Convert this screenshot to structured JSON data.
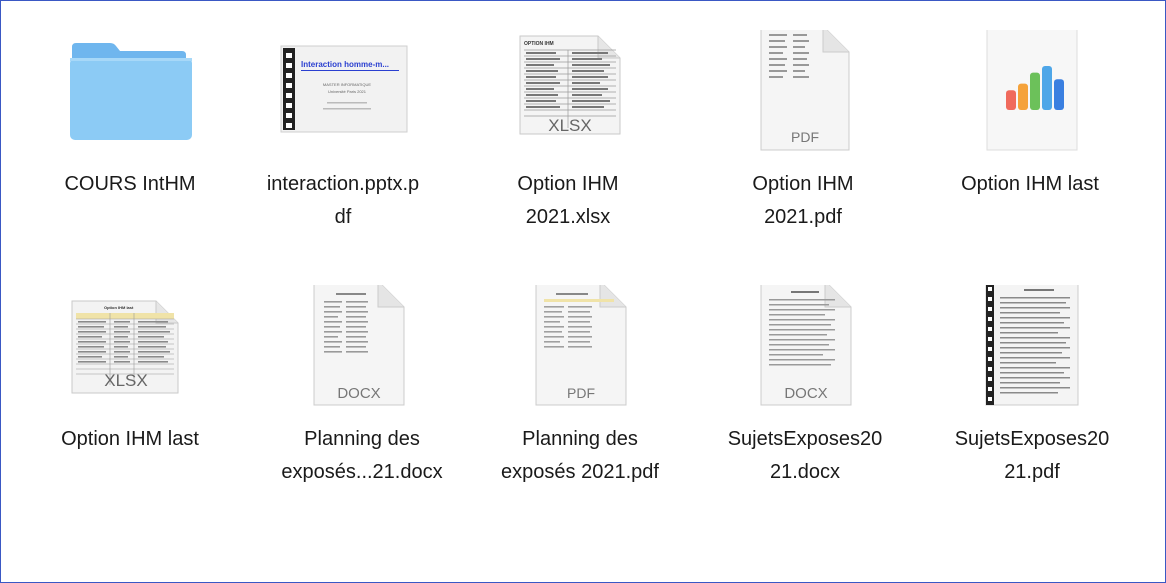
{
  "items": [
    {
      "type": "folder",
      "line1": "COURS IntHM",
      "line2": ""
    },
    {
      "type": "pptx-pdf",
      "line1": "interaction.pptx.p",
      "line2": "df",
      "preview": {
        "title": "Interaction homme-m...",
        "line_a": "MASTER INFORMATIQUE",
        "line_b": "Université Paris 2021"
      }
    },
    {
      "type": "xlsx",
      "line1": "Option IHM",
      "line2": "2021.xlsx",
      "badge": "XLSX",
      "header": "OPTION IHM"
    },
    {
      "type": "doc",
      "line1": "Option IHM",
      "line2": "2021.pdf",
      "badge": "PDF"
    },
    {
      "type": "numbers",
      "line1": "Option IHM last",
      "line2": "",
      "bars": [
        0.45,
        0.6,
        0.85,
        1.0,
        0.7
      ],
      "bar_colors": [
        "#f06a5c",
        "#f5a23a",
        "#6cc15a",
        "#4ea6e8",
        "#3a7fe0"
      ]
    },
    {
      "type": "xlsx",
      "line1": "Option IHM last",
      "line2": "",
      "badge": "XLSX",
      "header": "Option IHM last"
    },
    {
      "type": "doc",
      "line1": "Planning des",
      "line2": "exposés...21.docx",
      "badge": "DOCX"
    },
    {
      "type": "doc",
      "line1": "Planning des",
      "line2": "exposés 2021.pdf",
      "badge": "PDF"
    },
    {
      "type": "doc",
      "line1": "SujetsExposes20",
      "line2": "21.docx",
      "badge": "DOCX"
    },
    {
      "type": "bound-pdf",
      "line1": "SujetsExposes20",
      "line2": "21.pdf"
    }
  ],
  "colors": {
    "frame_border": "#3a58c4",
    "folder_front": "#8ccbf5",
    "folder_back": "#6fb6ee",
    "label_text": "#1a1a1a",
    "badge_text": "#777777"
  }
}
